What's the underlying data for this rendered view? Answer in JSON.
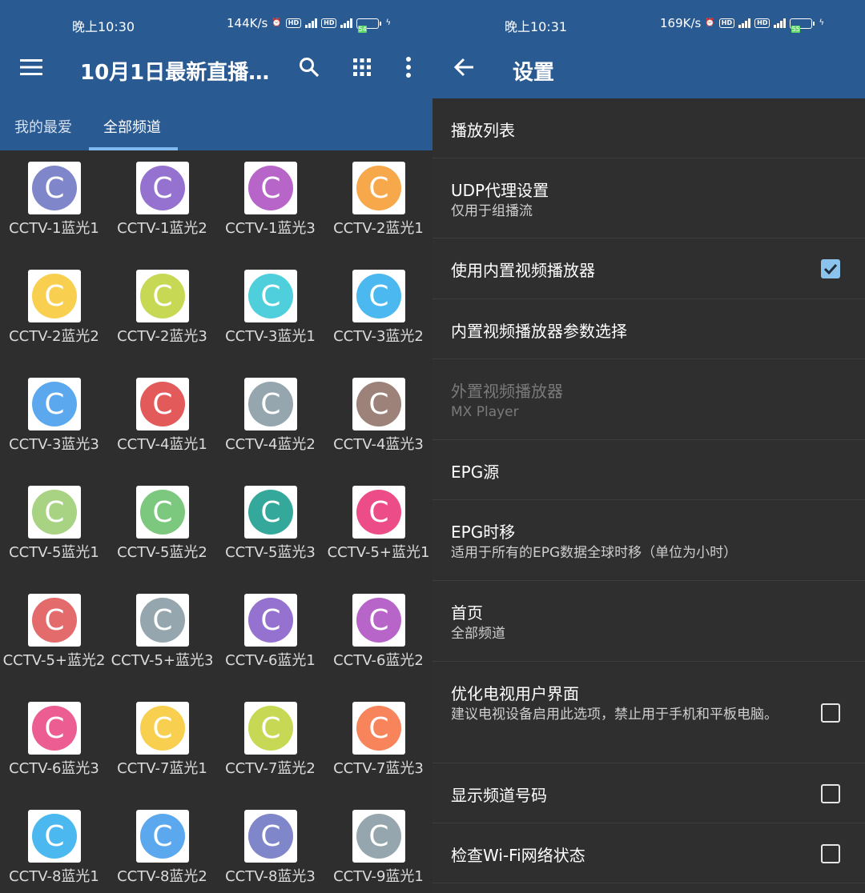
{
  "colors": {
    "appbar": "#2a5a92",
    "background": "#2e2e2e",
    "accent": "#8cc3ec",
    "tab_indicator": "#7fb9ef"
  },
  "left": {
    "status": {
      "time": "晚上10:30",
      "speed": "144K/s",
      "battery": "54"
    },
    "toolbar": {
      "title": "10月1日最新直播…",
      "menu_icon": "menu-icon",
      "search_icon": "search-icon",
      "grid_icon": "grid-view-icon",
      "more_icon": "more-vert-icon"
    },
    "tabs": [
      {
        "label": "我的最爱",
        "active": false
      },
      {
        "label": "全部频道",
        "active": true
      }
    ],
    "channels": [
      {
        "letter": "C",
        "name": "CCTV-1蓝光1",
        "color": "#7f86c9"
      },
      {
        "letter": "C",
        "name": "CCTV-1蓝光2",
        "color": "#9572d0"
      },
      {
        "letter": "C",
        "name": "CCTV-1蓝光3",
        "color": "#b765c9"
      },
      {
        "letter": "C",
        "name": "CCTV-2蓝光1",
        "color": "#f6a84a"
      },
      {
        "letter": "C",
        "name": "CCTV-2蓝光2",
        "color": "#f8cf4e"
      },
      {
        "letter": "C",
        "name": "CCTV-2蓝光3",
        "color": "#c7d854"
      },
      {
        "letter": "C",
        "name": "CCTV-3蓝光1",
        "color": "#4fcfdb"
      },
      {
        "letter": "C",
        "name": "CCTV-3蓝光2",
        "color": "#4bb8f0"
      },
      {
        "letter": "C",
        "name": "CCTV-3蓝光3",
        "color": "#5ba8ef"
      },
      {
        "letter": "C",
        "name": "CCTV-4蓝光1",
        "color": "#e35a5a"
      },
      {
        "letter": "C",
        "name": "CCTV-4蓝光2",
        "color": "#96a6ae"
      },
      {
        "letter": "C",
        "name": "CCTV-4蓝光3",
        "color": "#9c8279"
      },
      {
        "letter": "C",
        "name": "CCTV-5蓝光1",
        "color": "#a7d383"
      },
      {
        "letter": "C",
        "name": "CCTV-5蓝光2",
        "color": "#7cc87e"
      },
      {
        "letter": "C",
        "name": "CCTV-5蓝光3",
        "color": "#34a89a"
      },
      {
        "letter": "C",
        "name": "CCTV-5+蓝光1",
        "color": "#ec4d88"
      },
      {
        "letter": "C",
        "name": "CCTV-5+蓝光2",
        "color": "#e36b6b"
      },
      {
        "letter": "C",
        "name": "CCTV-5+蓝光3",
        "color": "#96a6ae"
      },
      {
        "letter": "C",
        "name": "CCTV-6蓝光1",
        "color": "#9572d0"
      },
      {
        "letter": "C",
        "name": "CCTV-6蓝光2",
        "color": "#b765c9"
      },
      {
        "letter": "C",
        "name": "CCTV-6蓝光3",
        "color": "#ec5d92"
      },
      {
        "letter": "C",
        "name": "CCTV-7蓝光1",
        "color": "#f8cf4e"
      },
      {
        "letter": "C",
        "name": "CCTV-7蓝光2",
        "color": "#c7d854"
      },
      {
        "letter": "C",
        "name": "CCTV-7蓝光3",
        "color": "#f7845a"
      },
      {
        "letter": "C",
        "name": "CCTV-8蓝光1",
        "color": "#4bb8f0"
      },
      {
        "letter": "C",
        "name": "CCTV-8蓝光2",
        "color": "#5ba8ef"
      },
      {
        "letter": "C",
        "name": "CCTV-8蓝光3",
        "color": "#7f86c9"
      },
      {
        "letter": "C",
        "name": "CCTV-9蓝光1",
        "color": "#96a6ae"
      }
    ]
  },
  "right": {
    "status": {
      "time": "晚上10:31",
      "speed": "169K/s",
      "battery": "55"
    },
    "toolbar": {
      "title": "设置",
      "back_icon": "arrow-back-icon"
    },
    "settings": [
      {
        "title": "播放列表",
        "subtitle": "",
        "checkbox": null,
        "disabled": false
      },
      {
        "title": "UDP代理设置",
        "subtitle": "仅用于组播流",
        "checkbox": null,
        "disabled": false
      },
      {
        "title": "使用内置视频播放器",
        "subtitle": "",
        "checkbox": true,
        "disabled": false
      },
      {
        "title": "内置视频播放器参数选择",
        "subtitle": "",
        "checkbox": null,
        "disabled": false
      },
      {
        "title": "外置视频播放器",
        "subtitle": "MX Player",
        "checkbox": null,
        "disabled": true
      },
      {
        "title": "EPG源",
        "subtitle": "",
        "checkbox": null,
        "disabled": false
      },
      {
        "title": "EPG时移",
        "subtitle": "适用于所有的EPG数据全球时移（单位为小时）",
        "checkbox": null,
        "disabled": false
      },
      {
        "title": "首页",
        "subtitle": "全部频道",
        "checkbox": null,
        "disabled": false
      },
      {
        "title": "优化电视用户界面",
        "subtitle": "建议电视设备启用此选项，禁止用于手机和平板电脑。",
        "checkbox": false,
        "disabled": false
      },
      {
        "title": "显示频道号码",
        "subtitle": "",
        "checkbox": false,
        "disabled": false
      },
      {
        "title": "检查Wi-Fi网络状态",
        "subtitle": "",
        "checkbox": false,
        "disabled": false
      }
    ]
  }
}
